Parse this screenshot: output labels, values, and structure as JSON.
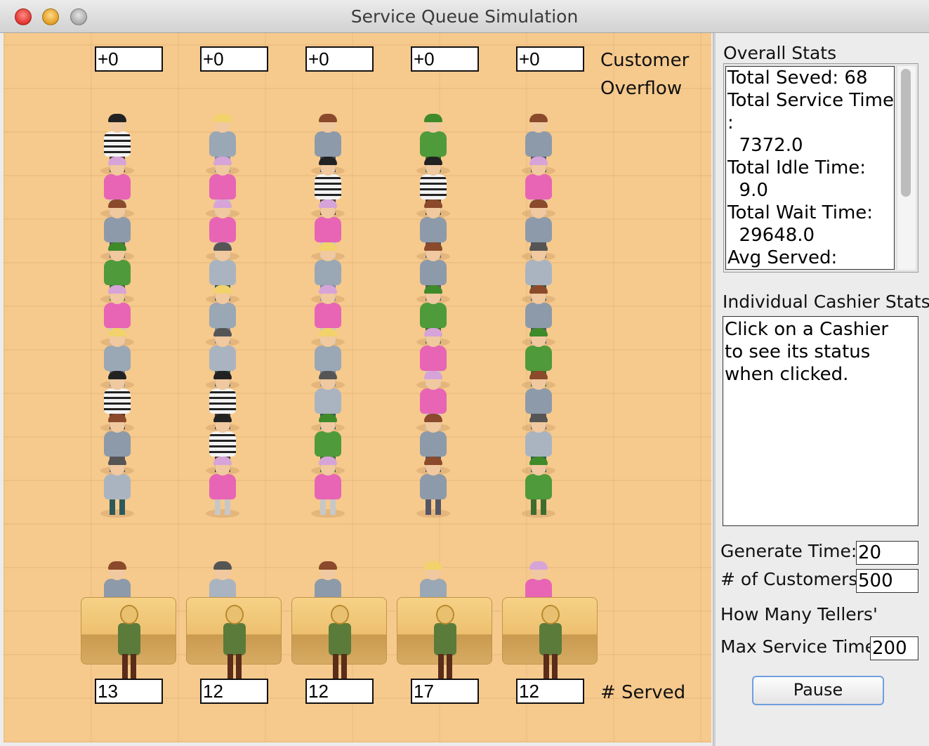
{
  "window": {
    "title": "Service Queue Simulation"
  },
  "overflow": {
    "values": [
      "+0",
      "+0",
      "+0",
      "+0",
      "+0"
    ],
    "label_line1": "Customer",
    "label_line2": "Overflow"
  },
  "served": {
    "values": [
      "13",
      "12",
      "12",
      "17",
      "12"
    ],
    "label": "# Served"
  },
  "overall_stats": {
    "title": "Overall Stats",
    "text": "Total Seved: 68\nTotal Service Time\n:\n  7372.0\nTotal Idle Time:\n  9.0\nTotal Wait Time:\n  29648.0\nAvg Served:"
  },
  "cashier_stats": {
    "title": "Individual Cashier Stats",
    "text": "Click on a Cashier\nto see its status\nwhen clicked."
  },
  "controls": {
    "generate_time_label": "Generate Time:",
    "generate_time_value": "20",
    "customers_label": "# of Customers",
    "customers_value": "500",
    "tellers_label": "How Many Tellers'",
    "max_service_label": "Max Service Time",
    "max_service_value": "200",
    "pause_label": "Pause"
  },
  "colors": {
    "floor": "#f6c98d",
    "teller_shirt": "#5b7b3b",
    "button_focus": "#6f9ee0"
  }
}
